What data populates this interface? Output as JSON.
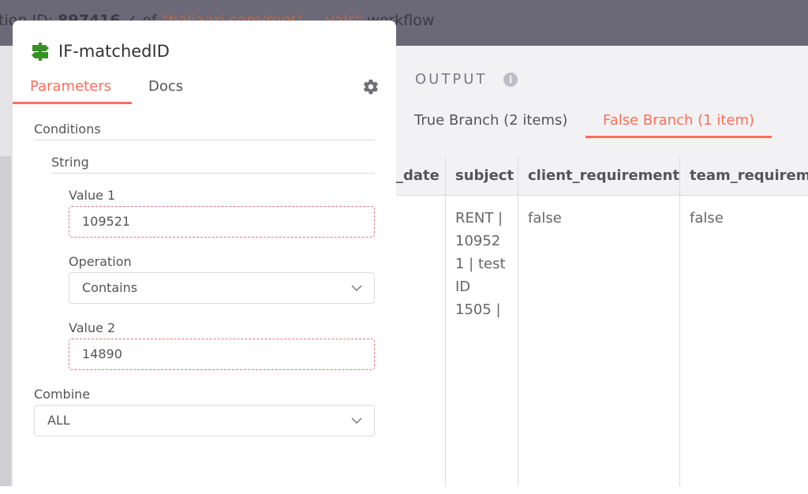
{
  "topbar": {
    "prefix": "ution ID: ",
    "execution_id": "897416",
    "of_text": " ✓ of ",
    "workflow_name": "\"baliaari.com/rent/ ... yals\"",
    "suffix": " workflow"
  },
  "modal": {
    "node_title": "IF-matchedID",
    "tabs": {
      "parameters": "Parameters",
      "docs": "Docs"
    },
    "sections": {
      "conditions": "Conditions",
      "string": "String"
    },
    "value1": {
      "label": "Value 1",
      "value": "109521"
    },
    "operation": {
      "label": "Operation",
      "selected": "Contains"
    },
    "value2": {
      "label": "Value 2",
      "value": "14890"
    },
    "combine": {
      "label": "Combine",
      "selected": "ALL"
    }
  },
  "output": {
    "title": "OUTPUT",
    "tabs": {
      "true_branch": "True Branch (2 items)",
      "false_branch": "False Branch (1 item)"
    },
    "columns": [
      "_date",
      "subject",
      "client_requirement",
      "team_requireme"
    ],
    "row": [
      "",
      "RENT | 109521 | test ID 1505 |",
      "false",
      "false"
    ]
  },
  "colors": {
    "accent": "#ff6d5a",
    "node_icon": "#3a8f2a",
    "error_border": "#e5768a"
  }
}
